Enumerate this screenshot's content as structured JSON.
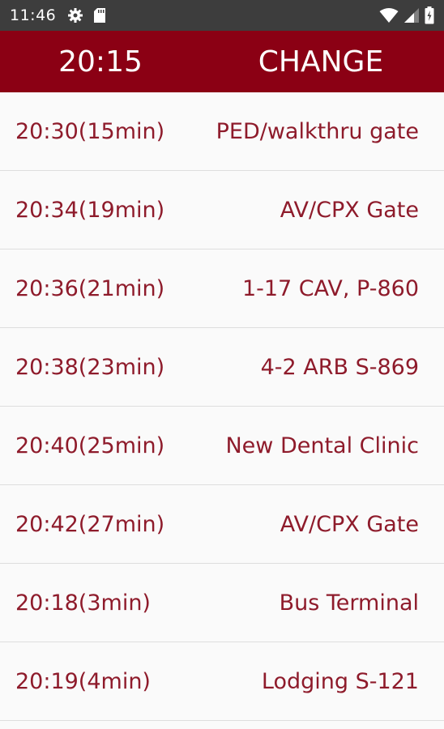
{
  "status_bar": {
    "time": "11:46",
    "left_icons": [
      "gear-icon",
      "sd-card-icon"
    ],
    "right_icons": [
      "wifi-icon",
      "cell-signal-icon",
      "battery-icon"
    ]
  },
  "header": {
    "current_time": "20:15",
    "change_label": "CHANGE"
  },
  "colors": {
    "status_bar_bg": "#3d3d3d",
    "header_bg": "#8b0014",
    "row_text": "#8e1b2b",
    "list_bg": "#fafafa",
    "divider": "#dedede"
  },
  "schedule": [
    {
      "time": "20:30(15min)",
      "stop": "PED/walkthru gate"
    },
    {
      "time": "20:34(19min)",
      "stop": "AV/CPX Gate"
    },
    {
      "time": "20:36(21min)",
      "stop": "1-17 CAV, P-860"
    },
    {
      "time": "20:38(23min)",
      "stop": "4-2 ARB S-869"
    },
    {
      "time": "20:40(25min)",
      "stop": "New Dental Clinic"
    },
    {
      "time": "20:42(27min)",
      "stop": "AV/CPX Gate"
    },
    {
      "time": "20:18(3min)",
      "stop": "Bus Terminal"
    },
    {
      "time": "20:19(4min)",
      "stop": "Lodging S-121"
    }
  ]
}
